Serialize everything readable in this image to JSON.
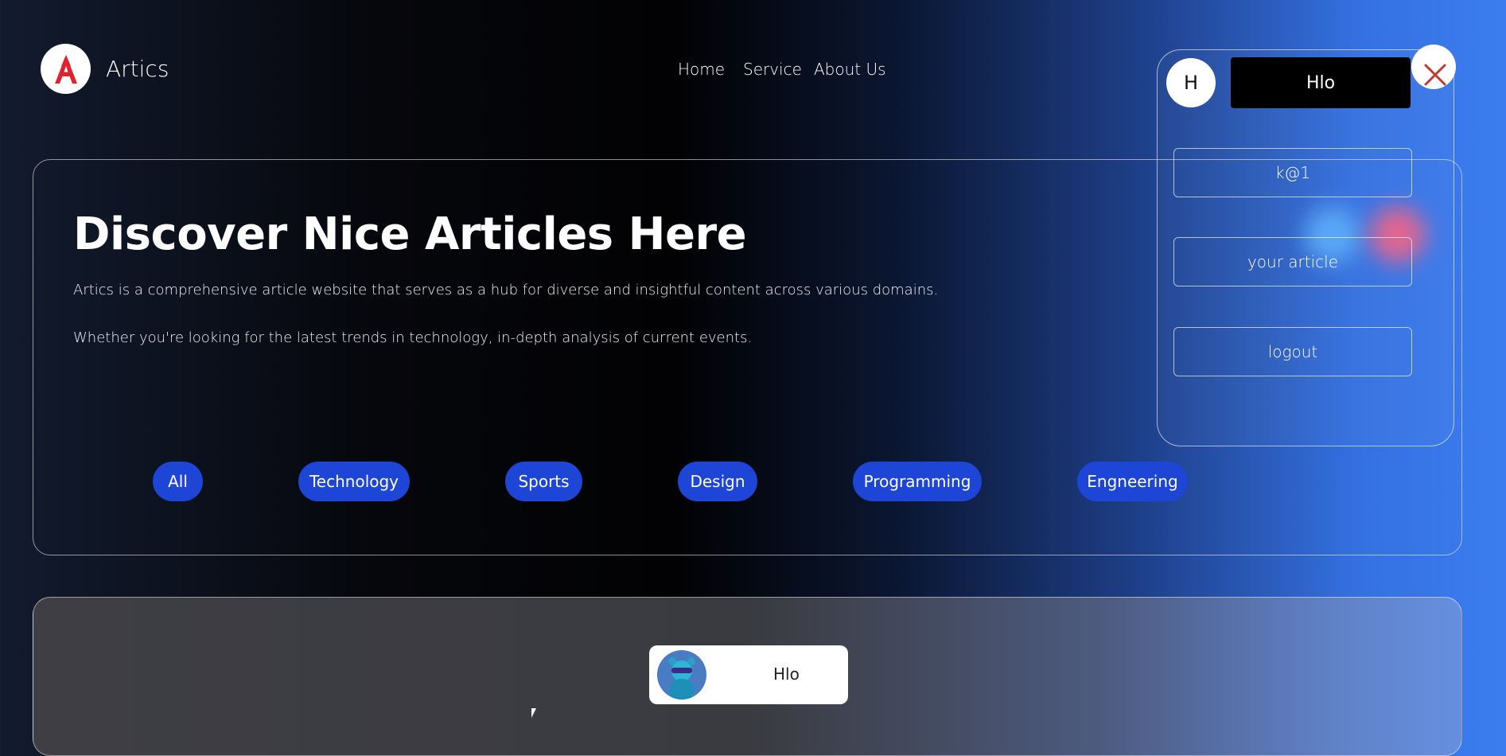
{
  "header": {
    "brand": "Artics",
    "logo_icon": "angular-a-logo",
    "nav": [
      "Home",
      "Service",
      "About Us"
    ]
  },
  "hero": {
    "title": "Discover Nice Articles Here",
    "p1": "Artics is a comprehensive article website that serves as a hub for diverse and insightful content across various domains.",
    "p2": "Whether you're looking for the latest trends in technology, in-depth analysis of current events.",
    "categories": [
      "All",
      "Technology",
      "Sports",
      "Design",
      "Programming",
      "Engneering"
    ]
  },
  "profile_panel": {
    "avatar_letter": "H",
    "username": "Hlo",
    "items": [
      "k@1",
      "your article",
      "logout"
    ],
    "close_icon": "close-icon",
    "close_color": "#c0392b"
  },
  "card": {
    "name": "Hlo",
    "avatar_icon": "dog-avatar"
  },
  "colors": {
    "accent": "#1d45d6",
    "logo_red": "#dd2230"
  }
}
